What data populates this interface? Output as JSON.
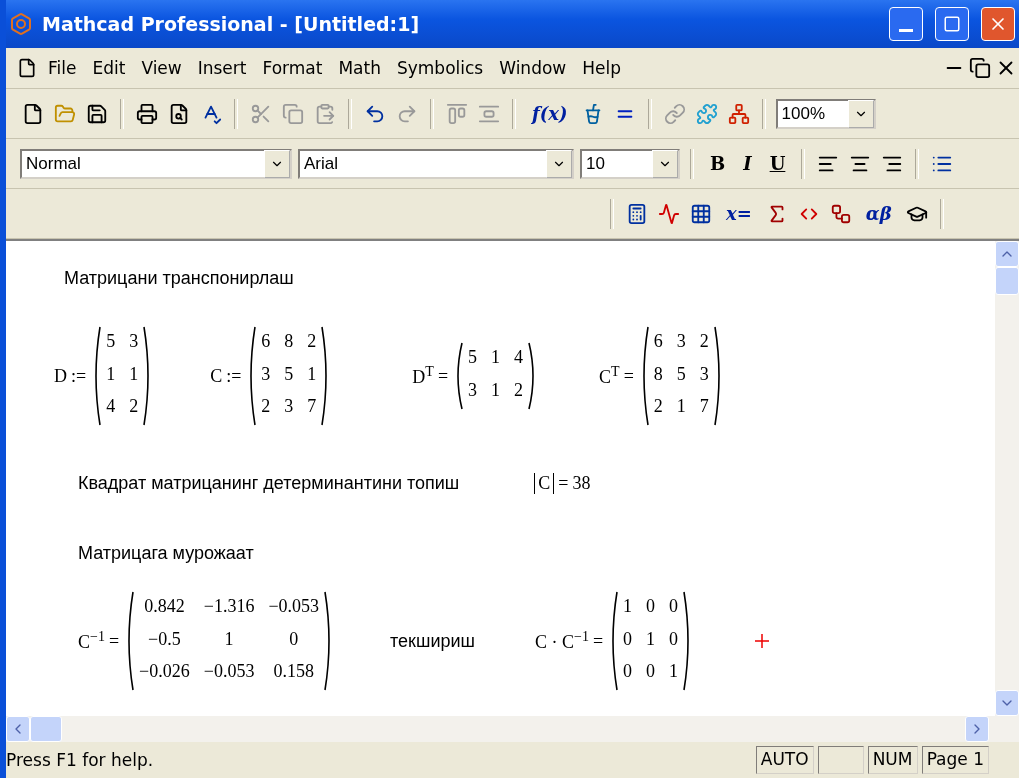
{
  "window": {
    "title": "Mathcad Professional - [Untitled:1]"
  },
  "menu": [
    {
      "label": "File"
    },
    {
      "label": "Edit"
    },
    {
      "label": "View"
    },
    {
      "label": "Insert"
    },
    {
      "label": "Format"
    },
    {
      "label": "Math"
    },
    {
      "label": "Symbolics"
    },
    {
      "label": "Window"
    },
    {
      "label": "Help"
    }
  ],
  "standard_toolbar": {
    "function_label": "f(x)",
    "zoom": "100%"
  },
  "format_toolbar": {
    "style": "Normal",
    "font": "Arial",
    "size": "10",
    "bold_label": "B",
    "italic_label": "I",
    "underline_label": "U"
  },
  "math_toolbar": {
    "evaluation_label": "x=",
    "greek_label": "αβ"
  },
  "worksheet": {
    "rows": [
      {
        "items": [
          {
            "kind": "text",
            "text": "Матрицани транспонирлаш"
          }
        ]
      },
      {
        "items": [
          {
            "kind": "matrix",
            "lhs": "D",
            "op": ":=",
            "rows": [
              [
                "5",
                "3"
              ],
              [
                "1",
                "1"
              ],
              [
                "4",
                "2"
              ]
            ]
          },
          {
            "kind": "matrix",
            "lhs": "C",
            "op": ":=",
            "rows": [
              [
                "6",
                "8",
                "2"
              ],
              [
                "3",
                "5",
                "1"
              ],
              [
                "2",
                "3",
                "7"
              ]
            ]
          },
          {
            "kind": "matrix",
            "lhs": "D$^{T}$",
            "op": "=",
            "rows": [
              [
                "5",
                "1",
                "4"
              ],
              [
                "3",
                "1",
                "2"
              ]
            ]
          },
          {
            "kind": "matrix",
            "lhs": "C$^{T}$",
            "op": "=",
            "rows": [
              [
                "6",
                "3",
                "2"
              ],
              [
                "8",
                "5",
                "3"
              ],
              [
                "2",
                "1",
                "7"
              ]
            ]
          }
        ]
      },
      {
        "items": [
          {
            "kind": "text",
            "text": "Квадрат матрицанинг детерминантини топиш"
          },
          {
            "kind": "abs",
            "arg": "C",
            "op": "=",
            "result": "38"
          }
        ]
      },
      {
        "items": [
          {
            "kind": "text",
            "text": "Матрицага мурожаат"
          }
        ]
      },
      {
        "items": [
          {
            "kind": "matrix",
            "lhs": "C$^{−1}$",
            "op": "=",
            "rows": [
              [
                "0.842",
                "−1.316",
                "−0.053"
              ],
              [
                "−0.5",
                "1",
                "0"
              ],
              [
                "−0.026",
                "−0.053",
                "0.158"
              ]
            ]
          },
          {
            "kind": "text",
            "text": "текшириш"
          },
          {
            "kind": "matrix",
            "lhs": "C · C$^{−1}$",
            "op": "=",
            "rows": [
              [
                "1",
                "0",
                "0"
              ],
              [
                "0",
                "1",
                "0"
              ],
              [
                "0",
                "0",
                "1"
              ]
            ]
          },
          {
            "kind": "cursor"
          }
        ]
      }
    ]
  },
  "status_bar": {
    "message": "Press F1 for help.",
    "panes": [
      {
        "kind": "indicator",
        "text": "AUTO"
      },
      {
        "kind": "blank"
      },
      {
        "kind": "indicator",
        "text": "NUM"
      },
      {
        "kind": "indicator",
        "text": "Page 1"
      }
    ]
  }
}
